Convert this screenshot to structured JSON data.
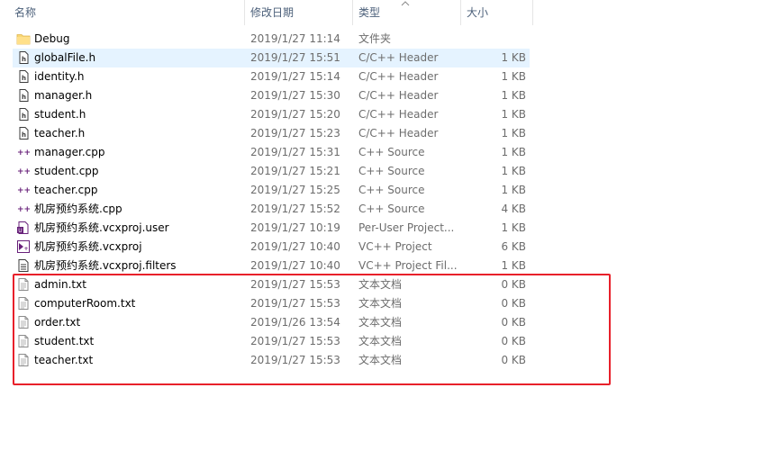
{
  "header": {
    "name": "名称",
    "date": "修改日期",
    "type": "类型",
    "size": "大小"
  },
  "files": [
    {
      "name": "Debug",
      "date": "2019/1/27 11:14",
      "type": "文件夹",
      "size": "",
      "icon": "folder-icon"
    },
    {
      "name": "globalFile.h",
      "date": "2019/1/27 15:51",
      "type": "C/C++ Header",
      "size": "1 KB",
      "icon": "header-file-icon"
    },
    {
      "name": "identity.h",
      "date": "2019/1/27 15:14",
      "type": "C/C++ Header",
      "size": "1 KB",
      "icon": "header-file-icon"
    },
    {
      "name": "manager.h",
      "date": "2019/1/27 15:30",
      "type": "C/C++ Header",
      "size": "1 KB",
      "icon": "header-file-icon"
    },
    {
      "name": "student.h",
      "date": "2019/1/27 15:20",
      "type": "C/C++ Header",
      "size": "1 KB",
      "icon": "header-file-icon"
    },
    {
      "name": "teacher.h",
      "date": "2019/1/27 15:23",
      "type": "C/C++ Header",
      "size": "1 KB",
      "icon": "header-file-icon"
    },
    {
      "name": "manager.cpp",
      "date": "2019/1/27 15:31",
      "type": "C++ Source",
      "size": "1 KB",
      "icon": "cpp-source-icon"
    },
    {
      "name": "student.cpp",
      "date": "2019/1/27 15:21",
      "type": "C++ Source",
      "size": "1 KB",
      "icon": "cpp-source-icon"
    },
    {
      "name": "teacher.cpp",
      "date": "2019/1/27 15:25",
      "type": "C++ Source",
      "size": "1 KB",
      "icon": "cpp-source-icon"
    },
    {
      "name": "机房预约系统.cpp",
      "date": "2019/1/27 15:52",
      "type": "C++ Source",
      "size": "4 KB",
      "icon": "cpp-source-icon"
    },
    {
      "name": "机房预约系统.vcxproj.user",
      "date": "2019/1/27 10:19",
      "type": "Per-User Project...",
      "size": "1 KB",
      "icon": "user-project-icon"
    },
    {
      "name": "机房预约系统.vcxproj",
      "date": "2019/1/27 10:40",
      "type": "VC++ Project",
      "size": "6 KB",
      "icon": "vcxproj-icon"
    },
    {
      "name": "机房预约系统.vcxproj.filters",
      "date": "2019/1/27 10:40",
      "type": "VC++ Project Fil...",
      "size": "1 KB",
      "icon": "filters-file-icon"
    },
    {
      "name": "admin.txt",
      "date": "2019/1/27 15:53",
      "type": "文本文档",
      "size": "0 KB",
      "icon": "text-file-icon"
    },
    {
      "name": "computerRoom.txt",
      "date": "2019/1/27 15:53",
      "type": "文本文档",
      "size": "0 KB",
      "icon": "text-file-icon"
    },
    {
      "name": "order.txt",
      "date": "2019/1/26 13:54",
      "type": "文本文档",
      "size": "0 KB",
      "icon": "text-file-icon"
    },
    {
      "name": "student.txt",
      "date": "2019/1/27 15:53",
      "type": "文本文档",
      "size": "0 KB",
      "icon": "text-file-icon"
    },
    {
      "name": "teacher.txt",
      "date": "2019/1/27 15:53",
      "type": "文本文档",
      "size": "0 KB",
      "icon": "text-file-icon"
    }
  ],
  "selected_row": 1,
  "colors": {
    "selection": "#e5f3ff",
    "highlight_border": "#e8202a",
    "header_text": "#4c607a"
  }
}
